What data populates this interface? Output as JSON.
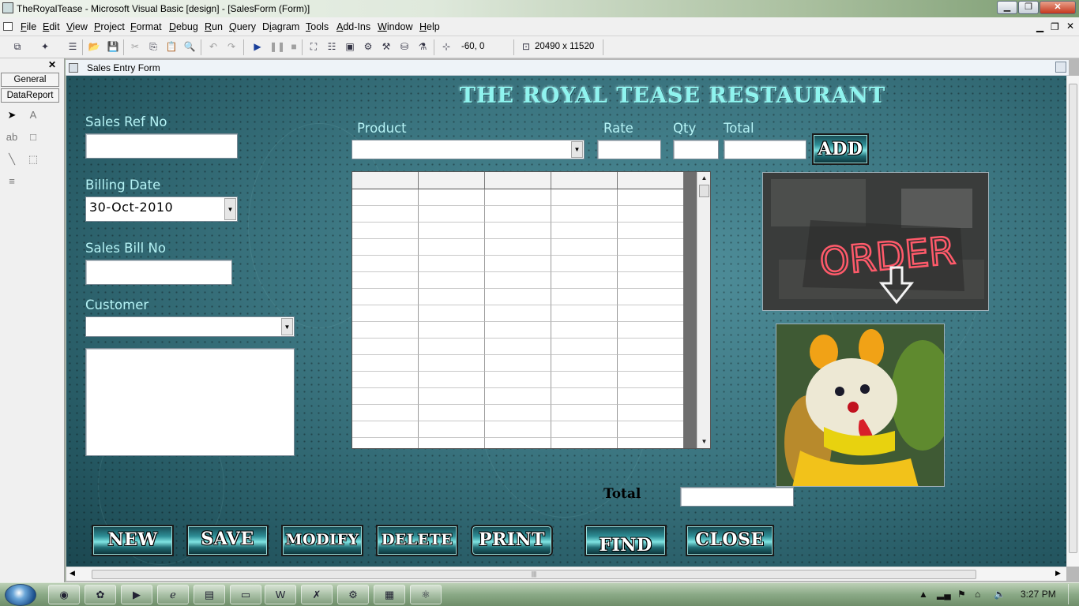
{
  "window": {
    "title": "TheRoyalTease - Microsoft Visual Basic [design] - [SalesForm (Form)]",
    "min_icon": "minimize-icon",
    "max_icon": "maximize-icon",
    "close_icon": "close-icon"
  },
  "menu": [
    "File",
    "Edit",
    "View",
    "Project",
    "Format",
    "Debug",
    "Run",
    "Query",
    "Diagram",
    "Tools",
    "Add-Ins",
    "Window",
    "Help"
  ],
  "toolbar": {
    "position": "-60, 0",
    "size": "20490 x 11520"
  },
  "toolbox": {
    "tabs": [
      "General",
      "DataReport"
    ]
  },
  "form": {
    "caption": "Sales Entry Form",
    "heading": "THE ROYAL TEASE RESTAURANT",
    "labels": {
      "sales_ref_no": "Sales Ref No",
      "billing_date": "Billing Date",
      "sales_bill_no": "Sales Bill No",
      "customer": "Customer",
      "product": "Product",
      "rate": "Rate",
      "qty": "Qty",
      "total": "Total",
      "grand_total": "Total"
    },
    "billing_date_value": "30-Oct-2010",
    "add_button": "ADD",
    "buttons": [
      "NEW",
      "SAVE",
      "MODIFY",
      "DELETE",
      "PRINT",
      "FIND",
      "CLOSE"
    ],
    "images": {
      "order_sign_text": "ORDER"
    }
  },
  "taskbar": {
    "clock": "3:27 PM"
  }
}
